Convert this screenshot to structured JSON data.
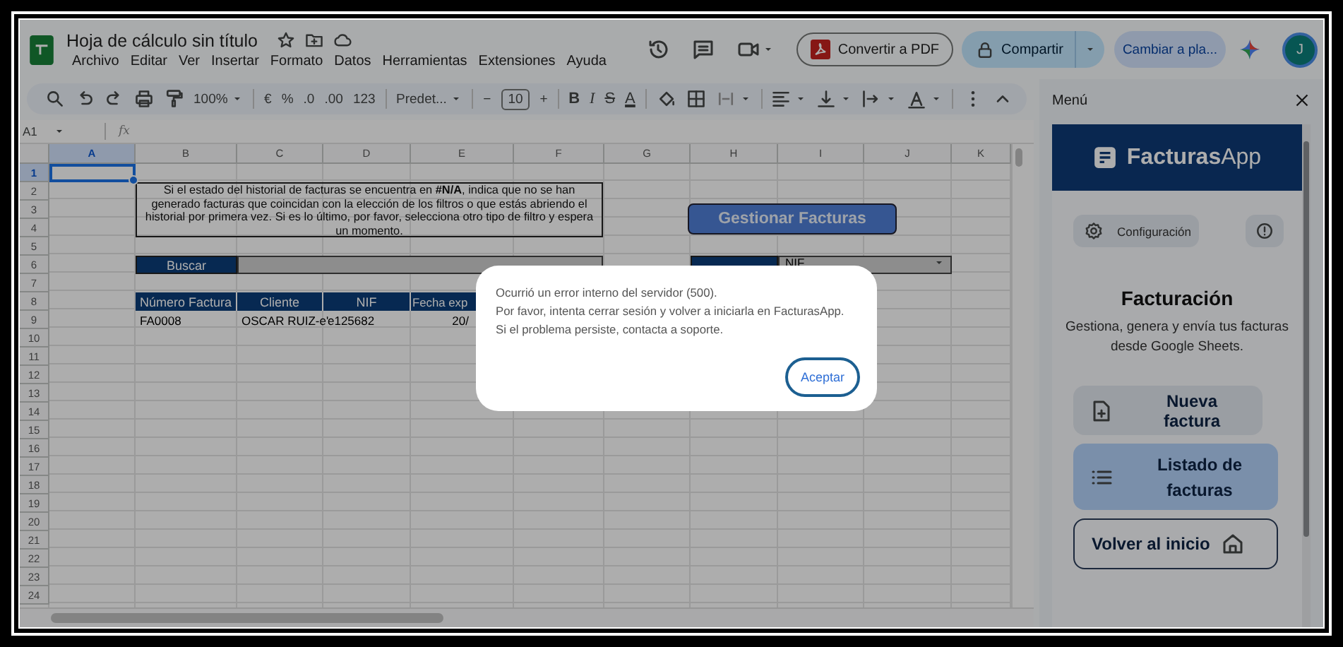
{
  "document": {
    "title": "Hoja de cálculo sin título"
  },
  "menu": [
    "Archivo",
    "Editar",
    "Ver",
    "Insertar",
    "Formato",
    "Datos",
    "Herramientas",
    "Extensiones",
    "Ayuda"
  ],
  "header_actions": {
    "pdf_button": "Convertir a PDF",
    "share_button": "Compartir",
    "switch_button": "Cambiar a pla...",
    "avatar": "J"
  },
  "toolbar": {
    "zoom": "100%",
    "currency": "€",
    "percent": "%",
    "decrease_decimals": ".0",
    "increase_decimals": ".00",
    "number_format": "123",
    "font": "Predet...",
    "font_size": "10",
    "minus": "−",
    "plus": "+",
    "format_letters": [
      "B",
      "I",
      "S",
      "A"
    ]
  },
  "formula_bar": {
    "name_box": "A1",
    "fx": "fx"
  },
  "grid": {
    "columns": [
      {
        "label": "A",
        "selected": true
      },
      {
        "label": "B",
        "selected": false
      },
      {
        "label": "C",
        "selected": false
      },
      {
        "label": "D",
        "selected": false
      },
      {
        "label": "E",
        "selected": false
      },
      {
        "label": "F",
        "selected": false
      },
      {
        "label": "G",
        "selected": false
      },
      {
        "label": "H",
        "selected": false
      },
      {
        "label": "I",
        "selected": false
      },
      {
        "label": "J",
        "selected": false
      },
      {
        "label": "K",
        "selected": false
      }
    ],
    "rows": [
      {
        "label": "1",
        "selected": true
      },
      {
        "label": "2",
        "selected": false
      },
      {
        "label": "3",
        "selected": false
      },
      {
        "label": "4",
        "selected": false
      },
      {
        "label": "5",
        "selected": false
      },
      {
        "label": "6",
        "selected": false
      },
      {
        "label": "7",
        "selected": false
      },
      {
        "label": "8",
        "selected": false
      },
      {
        "label": "9",
        "selected": false
      },
      {
        "label": "10",
        "selected": false
      },
      {
        "label": "11",
        "selected": false
      },
      {
        "label": "12",
        "selected": false
      },
      {
        "label": "13",
        "selected": false
      },
      {
        "label": "14",
        "selected": false
      },
      {
        "label": "15",
        "selected": false
      },
      {
        "label": "16",
        "selected": false
      },
      {
        "label": "17",
        "selected": false
      },
      {
        "label": "18",
        "selected": false
      },
      {
        "label": "19",
        "selected": false
      },
      {
        "label": "20",
        "selected": false
      },
      {
        "label": "21",
        "selected": false
      },
      {
        "label": "22",
        "selected": false
      },
      {
        "label": "23",
        "selected": false
      },
      {
        "label": "24",
        "selected": false
      }
    ],
    "notice": "Si el estado del historial de facturas se encuentra en **#N/A**, indica que no se han generado facturas que coincidan con la elección de los filtros o que estás abriendo el historial por primera vez. Si es lo último, por favor, selecciona otro tipo de filtro y espera un momento.",
    "search_label": "Buscar",
    "manage_button": "Gestionar Facturas",
    "filter_value": "NIF",
    "table": {
      "columns": [
        "Número Factura",
        "Cliente",
        "NIF",
        "Fecha exp"
      ],
      "rows": [
        [
          "FA0008",
          "OSCAR RUIZ-e'",
          "e125682",
          "20/"
        ]
      ]
    }
  },
  "side_panel": {
    "title": "Menú",
    "brand": "**Facturas**App",
    "config_button": "Configuración",
    "heading": "Facturación",
    "description": "Gestiona, genera y envía tus facturas desde Google Sheets.",
    "nav": [
      {
        "label": "Nueva factura",
        "kind": "soft",
        "selected": false
      },
      {
        "label": "Listado de facturas",
        "kind": "soft",
        "selected": true
      },
      {
        "label": "Volver al inicio",
        "kind": "outline",
        "selected": false
      }
    ]
  },
  "dialog": {
    "lines": [
      "Ocurrió un error interno del servidor (500).",
      "Por favor, intenta cerrar sesión y volver a iniciarla en FacturasApp.",
      "Si el problema persiste, contacta a soporte."
    ],
    "button": "Aceptar"
  }
}
